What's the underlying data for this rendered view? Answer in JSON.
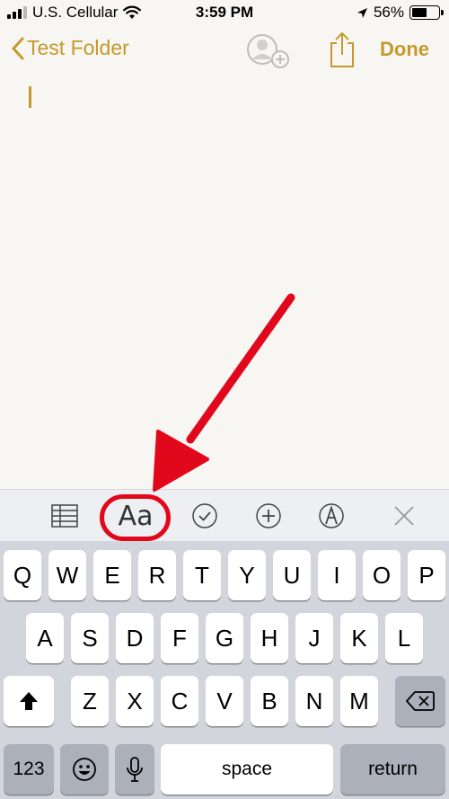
{
  "status_bar": {
    "carrier": "U.S. Cellular",
    "time": "3:59 PM",
    "battery": "56%",
    "battery_level": 0.56
  },
  "nav": {
    "back_label": "Test Folder",
    "done_label": "Done"
  },
  "toolbar": {
    "format_label": "Aa"
  },
  "keyboard": {
    "row1": [
      "Q",
      "W",
      "E",
      "R",
      "T",
      "Y",
      "U",
      "I",
      "O",
      "P"
    ],
    "row2": [
      "A",
      "S",
      "D",
      "F",
      "G",
      "H",
      "J",
      "K",
      "L"
    ],
    "row3": [
      "Z",
      "X",
      "C",
      "V",
      "B",
      "N",
      "M"
    ],
    "numbers_label": "123",
    "space_label": "space",
    "return_label": "return"
  },
  "colors": {
    "accent": "#c49a2c",
    "annotation": "#e2081b"
  }
}
